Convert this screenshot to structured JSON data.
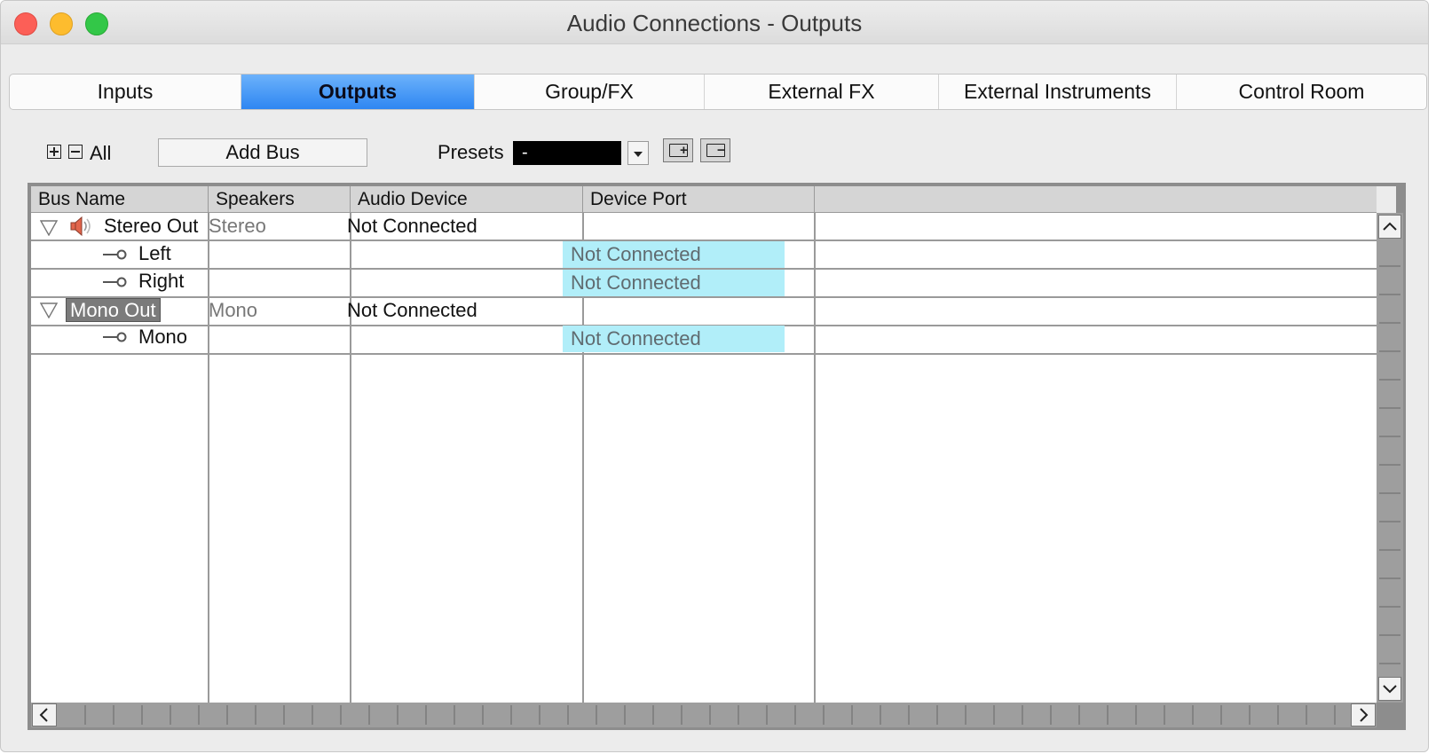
{
  "window": {
    "title": "Audio Connections - Outputs"
  },
  "tabs": [
    {
      "label": "Inputs",
      "active": false
    },
    {
      "label": "Outputs",
      "active": true
    },
    {
      "label": "Group/FX",
      "active": false
    },
    {
      "label": "External FX",
      "active": false
    },
    {
      "label": "External Instruments",
      "active": false
    },
    {
      "label": "Control Room",
      "active": false
    }
  ],
  "toolbar": {
    "all_label": "All",
    "add_bus_label": "Add Bus",
    "presets_label": "Presets",
    "presets_value": "-"
  },
  "table": {
    "columns": [
      "Bus Name",
      "Speakers",
      "Audio Device",
      "Device Port"
    ],
    "rows": [
      {
        "type": "bus",
        "name": "Stereo Out",
        "speakers": "Stereo",
        "device": "Not Connected",
        "port": "",
        "icon": "speaker-icon"
      },
      {
        "type": "channel",
        "name": "Left",
        "speakers": "",
        "device": "",
        "port": "Not Connected"
      },
      {
        "type": "channel",
        "name": "Right",
        "speakers": "",
        "device": "",
        "port": "Not Connected"
      },
      {
        "type": "bus",
        "name": "Mono Out",
        "speakers": "Mono",
        "device": "Not Connected",
        "port": "",
        "selected": true
      },
      {
        "type": "channel",
        "name": "Mono",
        "speakers": "",
        "device": "",
        "port": "Not Connected"
      }
    ]
  },
  "colors": {
    "active_tab": "#3a8ef5",
    "port_cell": "#b1eef9"
  }
}
